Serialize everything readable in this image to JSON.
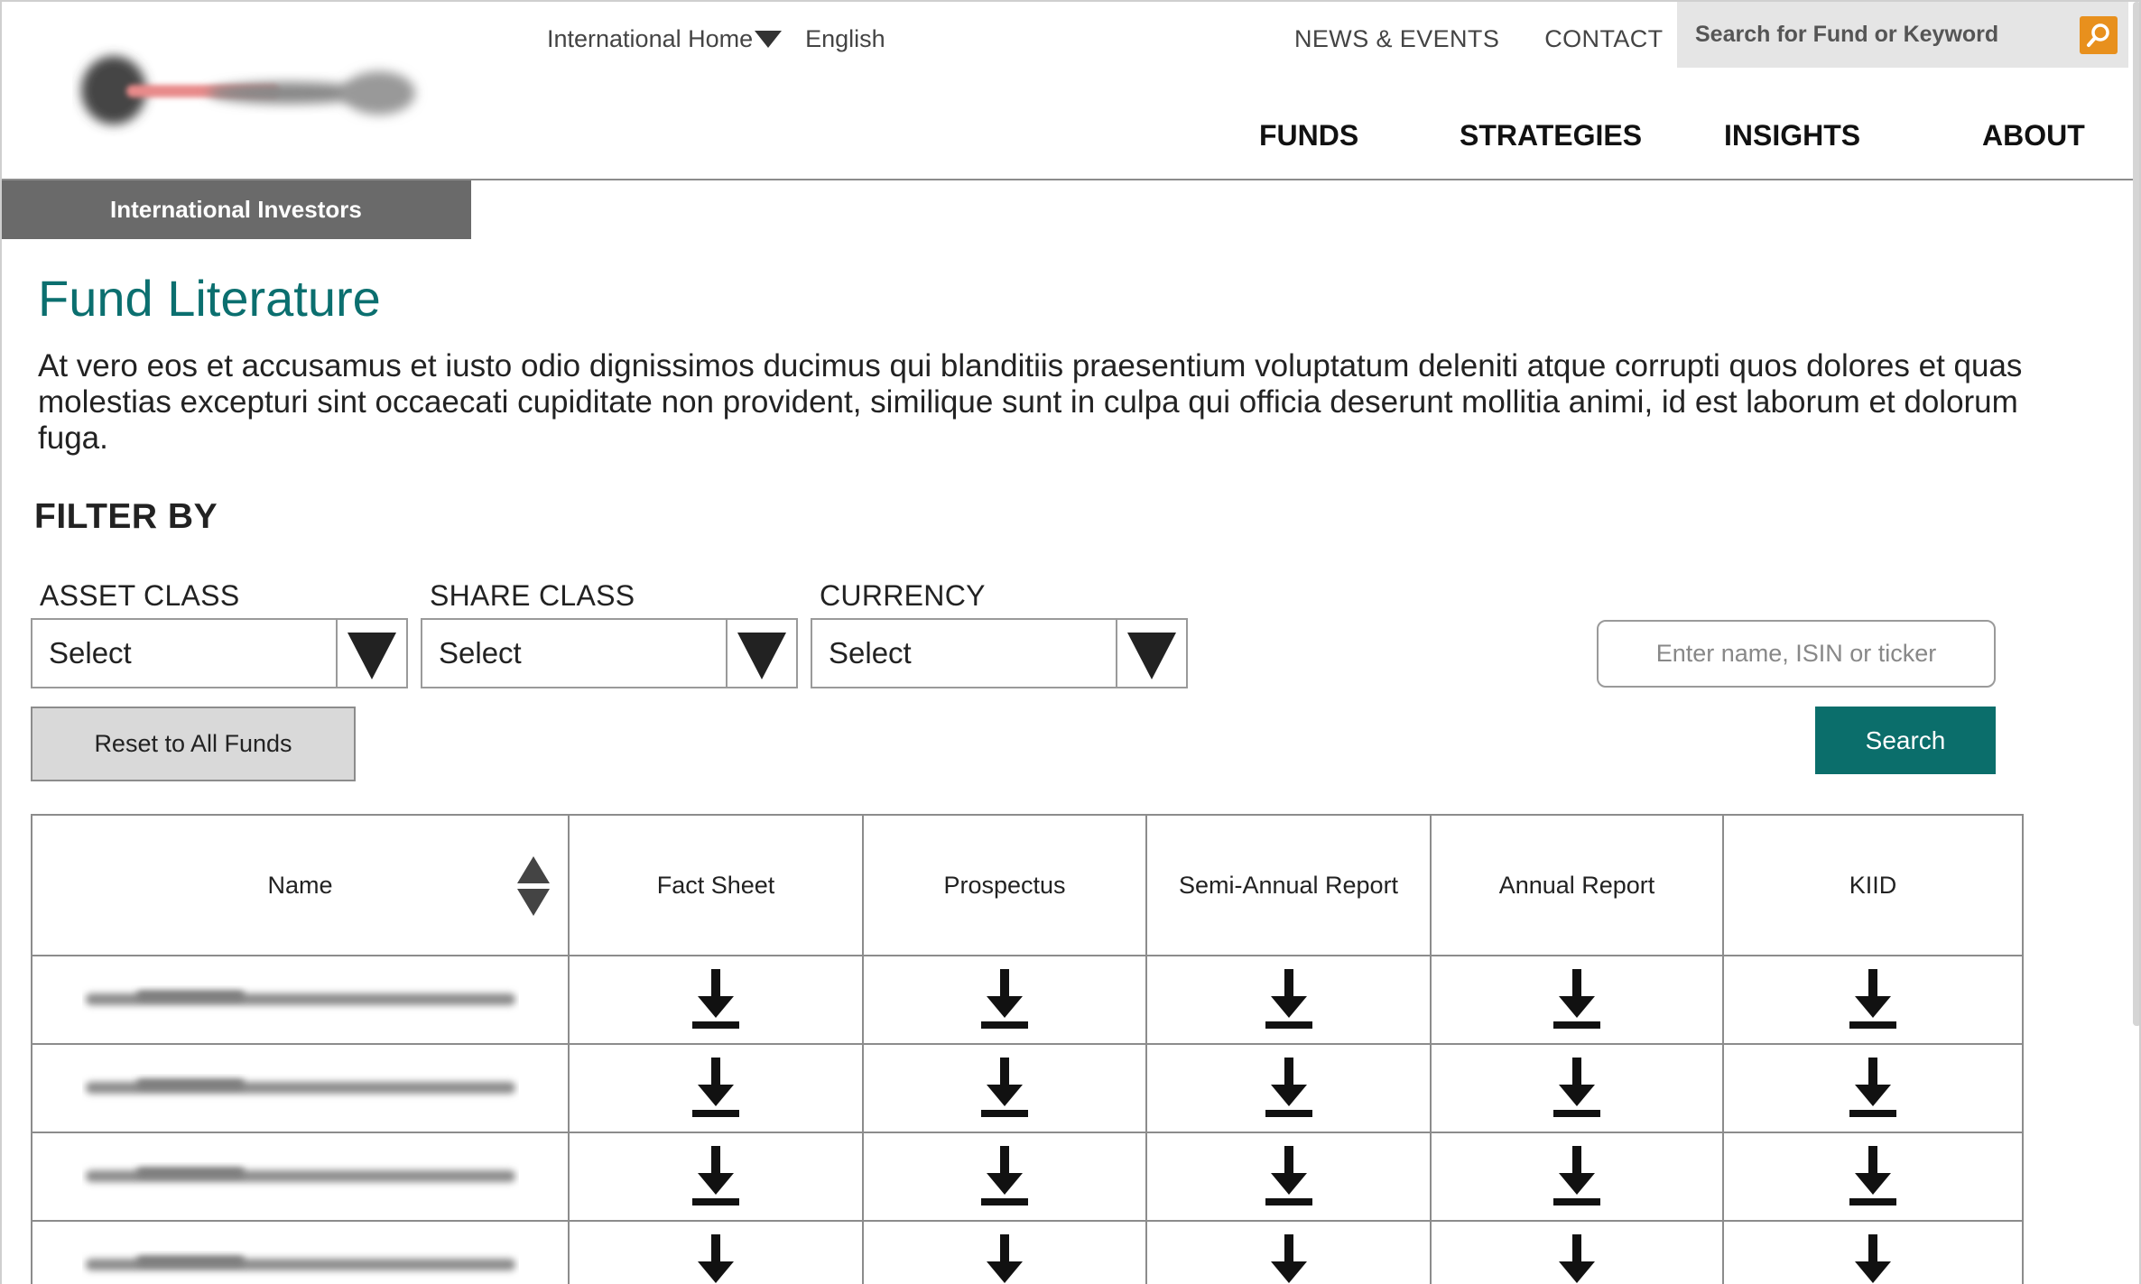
{
  "header": {
    "region_label": "International Home",
    "language": "English",
    "top_links": [
      "NEWS & EVENTS",
      "CONTACT"
    ],
    "search_placeholder": "Search for Fund or Keyword",
    "main_nav": [
      "FUNDS",
      "STRATEGIES",
      "INSIGHTS",
      "ABOUT"
    ],
    "section_tab": "International Investors",
    "accent_color": "#e8901d"
  },
  "main": {
    "title": "Fund Literature",
    "intro": "At vero eos et accusamus et iusto odio dignissimos ducimus qui blanditiis praesentium voluptatum deleniti atque corrupti quos dolores et quas molestias excepturi sint occaecati cupiditate non provident, similique sunt in culpa qui officia deserunt mollitia animi, id est laborum et dolorum fuga.",
    "title_color": "#0b6f6f"
  },
  "filters": {
    "heading": "FILTER BY",
    "asset_class": {
      "label": "ASSET CLASS",
      "value": "Select"
    },
    "share_class": {
      "label": "SHARE CLASS",
      "value": "Select"
    },
    "currency": {
      "label": "CURRENCY",
      "value": "Select"
    },
    "search_placeholder": "Enter name, ISIN or ticker",
    "reset_label": "Reset to All Funds",
    "search_label": "Search",
    "search_button_color": "#0b6e6b"
  },
  "table": {
    "columns": [
      "Name",
      "Fact Sheet",
      "Prospectus",
      "Semi-Annual Report",
      "Annual Report",
      "KIID"
    ],
    "row_count_visible": 4,
    "row_icon": "download-icon",
    "name_cells": "blurred"
  }
}
